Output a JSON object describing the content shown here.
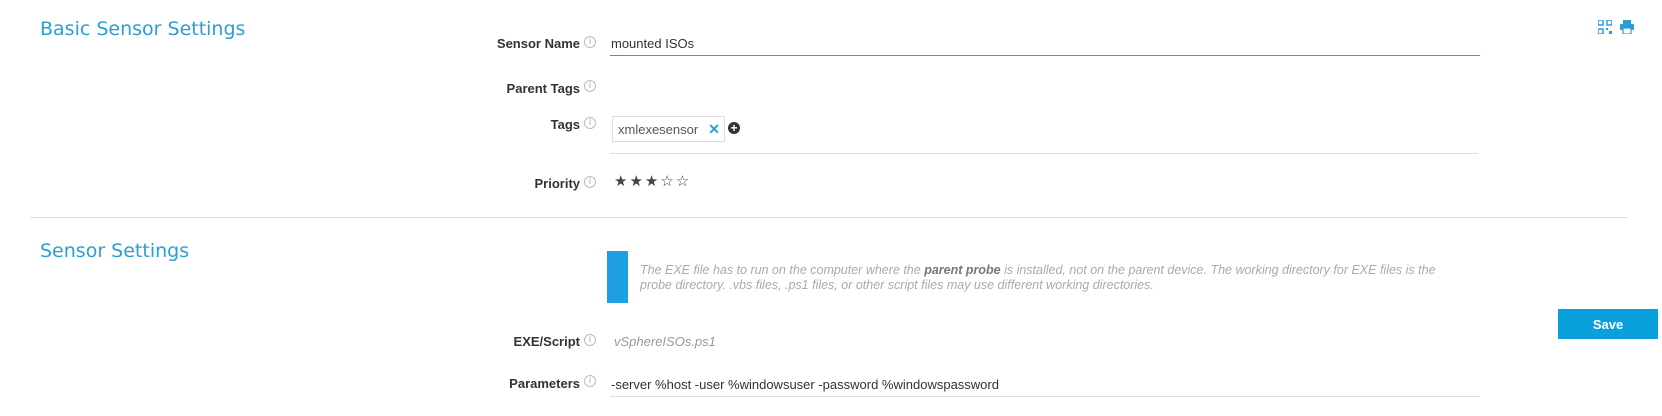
{
  "basic_settings": {
    "title": "Basic Sensor Settings",
    "sensor_name_label": "Sensor Name",
    "sensor_name_value": "mounted ISOs",
    "parent_tags_label": "Parent Tags",
    "tags_label": "Tags",
    "tags": [
      "xmlexesensor"
    ],
    "tag_remove_glyph": "✕",
    "add_tag_glyph": "+",
    "priority_label": "Priority",
    "priority_rating": 3,
    "priority_max": 5,
    "priority_stars": "★★★☆☆"
  },
  "sensor_settings": {
    "title": "Sensor Settings",
    "notice_prefix": "The EXE file has to run on the computer where the ",
    "notice_bold": "parent probe",
    "notice_suffix": " is installed, not on the parent device. The working directory for EXE files is the probe directory. .vbs files, .ps1 files, or other script files may use different working directories.",
    "exe_label": "EXE/Script",
    "exe_value": "vSphereISOs.ps1",
    "parameters_label": "Parameters",
    "parameters_value": "-server %host -user %windowsuser -password %windowspassword"
  },
  "actions": {
    "save_label": "Save"
  },
  "icons": {
    "info": "info-icon",
    "qr": "qr-code-icon",
    "print": "print-icon"
  },
  "colors": {
    "accent": "#2a9fd6",
    "save_button": "#0aa0dc",
    "notice_bar": "#1da1e2"
  }
}
